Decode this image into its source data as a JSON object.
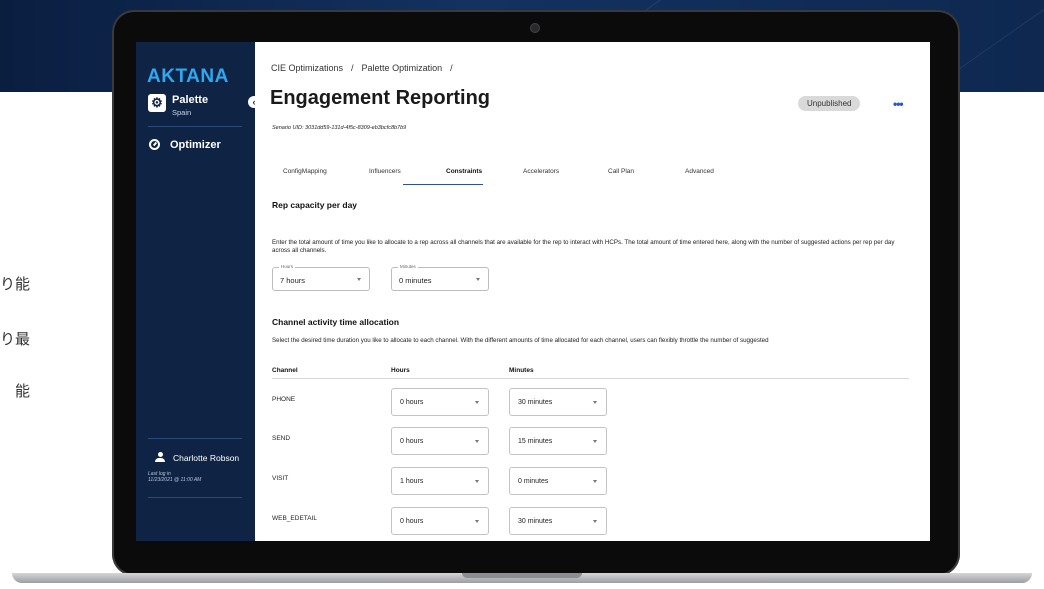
{
  "background": {
    "side_chars": [
      "り能",
      "り最",
      "能"
    ]
  },
  "sidebar": {
    "logo": "AKTANA",
    "app_name": "Palette",
    "app_subtitle": "Spain",
    "collapse_glyph": "‹",
    "nav_label": "Optimizer",
    "user_name": "Charlotte Robson",
    "last_log_label": "Last log in",
    "last_log_value": "11/23/2021 @ 11:00 AM"
  },
  "header": {
    "breadcrumb_1": "CIE Optimizations",
    "breadcrumb_sep_1": "/",
    "breadcrumb_2": "Palette Optimization",
    "breadcrumb_sep_2": "/",
    "title": "Engagement Reporting",
    "scenario_uid": "Senario UID: 3031dd59-131d-4f5c-8309-eb3bcfc8b7b9",
    "status_badge": "Unpublished",
    "more_menu": "•••"
  },
  "tabs": [
    "ConfigMapping",
    "Influencers",
    "Constraints",
    "Accelerators",
    "Call Plan",
    "Advanced"
  ],
  "active_tab": "Constraints",
  "rep_capacity": {
    "heading": "Rep capacity per day",
    "description": "Enter the total amount of time you like to allocate to a rep across all channels that are available for the rep to interact with HCPs. The total amount of time entered here, along with the number of suggested actions per rep per day across all channels.",
    "hours_label": "Hours",
    "hours_value": "7 hours",
    "minutes_label": "Minutes",
    "minutes_value": "0 minutes"
  },
  "channel_allocation": {
    "heading": "Channel activity time allocation",
    "description": "Select the desired time duration you like to allocate to each channel. With the different amounts of time allocated for each channel, users can flexibly throttle the number of suggested",
    "columns": [
      "Channel",
      "Hours",
      "Minutes"
    ],
    "rows": [
      {
        "channel": "PHONE",
        "hours": "0 hours",
        "minutes": "30 minutes"
      },
      {
        "channel": "SEND",
        "hours": "0 hours",
        "minutes": "15 minutes"
      },
      {
        "channel": "VISIT",
        "hours": "1 hours",
        "minutes": "0 minutes"
      },
      {
        "channel": "WEB_EDETAIL",
        "hours": "0 hours",
        "minutes": "30 minutes"
      }
    ]
  },
  "colors": {
    "sidebar_bg": "#0f2445",
    "logo": "#2ea8f0",
    "accent": "#2c4f9e",
    "badge_bg": "#d9d9d9"
  }
}
